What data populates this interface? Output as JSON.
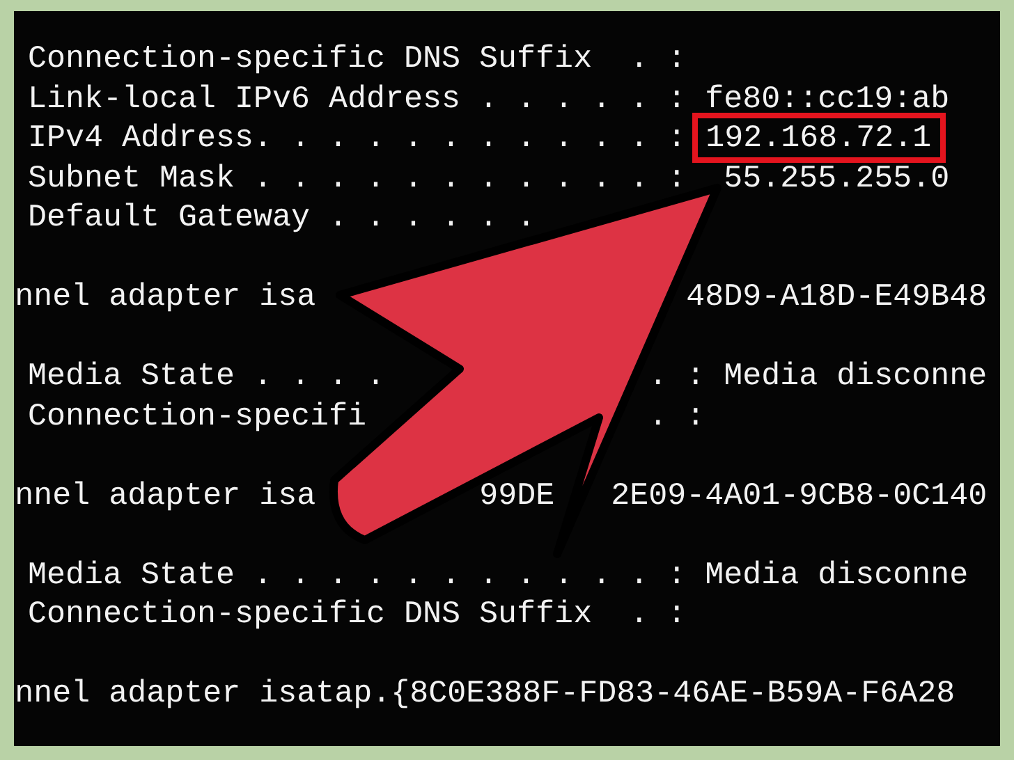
{
  "console": {
    "blocks": [
      {
        "lines": [
          {
            "segments": [
              {
                "text": "Connection-specific DNS Suffix  . :",
                "highlighted": false
              }
            ]
          },
          {
            "segments": [
              {
                "text": "Link-local IPv6 Address . . . . . : fe80::cc19:ab",
                "highlighted": false
              }
            ]
          },
          {
            "segments": [
              {
                "text": "IPv4 Address. . . . . . . . . . . :",
                "highlighted": false
              },
              {
                "text": "192.168.72.1",
                "highlighted": true
              }
            ]
          },
          {
            "segments": [
              {
                "text": "Subnet Mask . . . . . . . . . . . :",
                "highlighted": false
              },
              {
                "text": "55.255.255.0",
                "highlighted": false
              }
            ]
          },
          {
            "segments": [
              {
                "text": "Default Gateway . . . . . .",
                "highlighted": false
              }
            ]
          }
        ]
      },
      {
        "lines": [
          {
            "segments": [
              {
                "text": "nnel adapter isa",
                "highlighted": false
              },
              {
                "text": "48D9-A18D-E49B48",
                "highlighted": false
              }
            ]
          }
        ]
      },
      {
        "lines": [
          {
            "segments": [
              {
                "text": "Media State . . . .",
                "highlighted": false
              },
              {
                "text": ". : Media disconne",
                "highlighted": false
              }
            ]
          },
          {
            "segments": [
              {
                "text": "Connection-specifi",
                "highlighted": false
              },
              {
                "text": ". :",
                "highlighted": false
              }
            ]
          }
        ]
      },
      {
        "lines": [
          {
            "segments": [
              {
                "text": "nnel adapter isa",
                "highlighted": false
              },
              {
                "text": "99DE",
                "highlighted": false
              },
              {
                "text": "2E09-4A01-9CB8-0C140",
                "highlighted": false
              }
            ]
          }
        ]
      },
      {
        "lines": [
          {
            "segments": [
              {
                "text": "Media State . . . . . . . . . . . : Media disconne",
                "highlighted": false
              }
            ]
          },
          {
            "segments": [
              {
                "text": "Connection-specific DNS Suffix  . :",
                "highlighted": false
              }
            ]
          }
        ]
      },
      {
        "lines": [
          {
            "segments": [
              {
                "text": "nnel adapter isatap.{8C0E388F-FD83-46AE-B59A-F6A28",
                "highlighted": false
              }
            ]
          }
        ]
      }
    ]
  }
}
